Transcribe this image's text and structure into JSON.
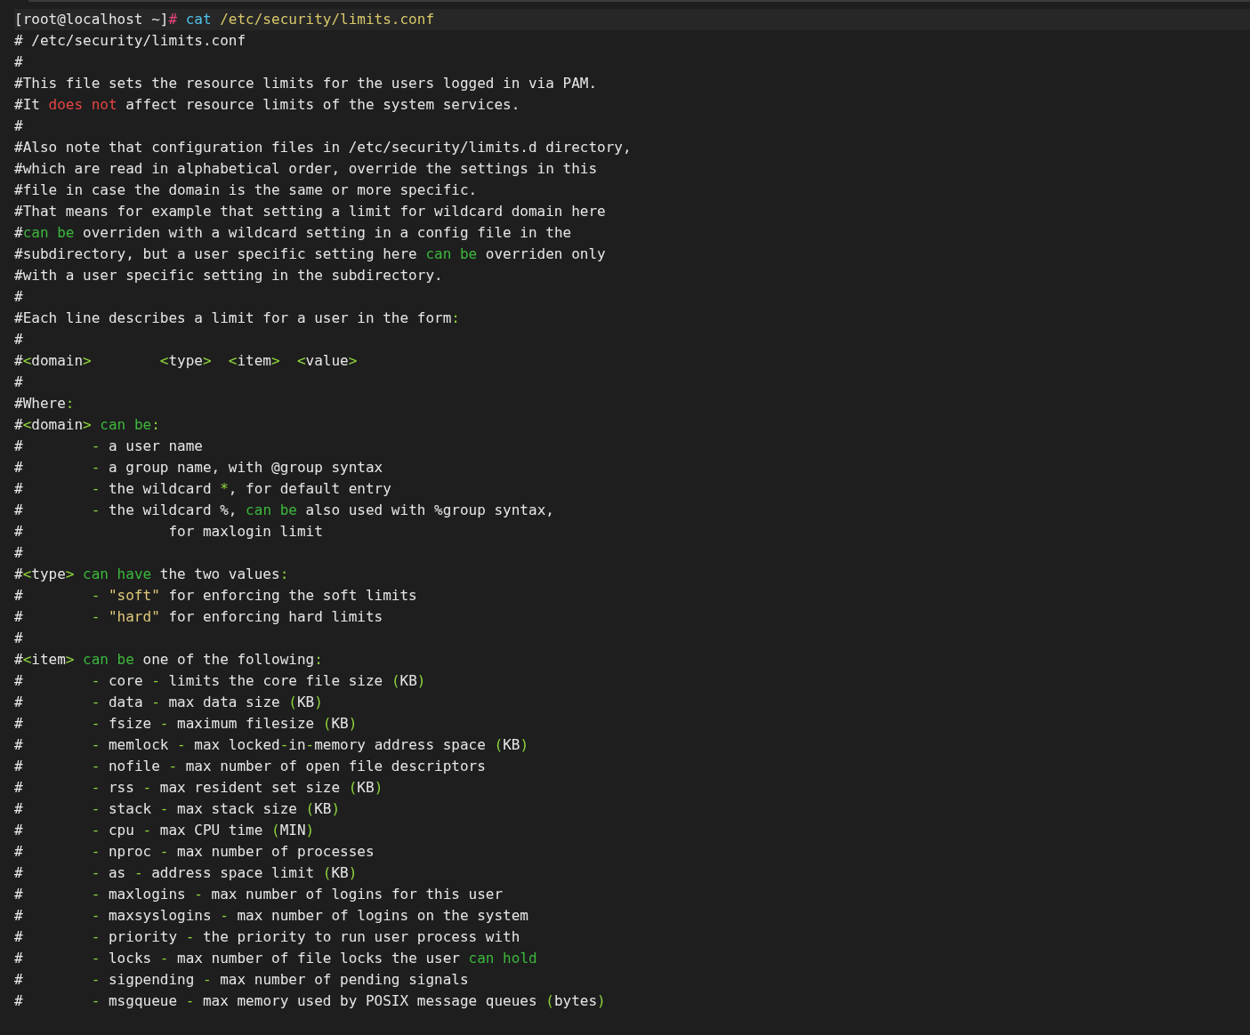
{
  "terminal": {
    "lines": [
      {
        "kind": "prompt",
        "segments": [
          {
            "kind": "plain",
            "text": "[root@localhost ~]"
          },
          {
            "kind": "hash",
            "text": "#"
          },
          {
            "kind": "command",
            "text": " cat"
          },
          {
            "kind": "path",
            "text": " /etc/security/limits.conf"
          }
        ]
      },
      {
        "kind": "output",
        "segments": [
          {
            "kind": "plain",
            "text": "# /etc/security/limits.conf"
          }
        ]
      },
      {
        "kind": "output",
        "segments": [
          {
            "kind": "plain",
            "text": "#"
          }
        ]
      },
      {
        "kind": "output",
        "segments": [
          {
            "kind": "plain",
            "text": "#This file sets the resource limits for the users logged in via PAM."
          }
        ]
      },
      {
        "kind": "output",
        "segments": [
          {
            "kind": "plain",
            "text": "#It "
          },
          {
            "kind": "negation",
            "text": "does not"
          },
          {
            "kind": "plain",
            "text": " affect resource limits of the system services."
          }
        ]
      },
      {
        "kind": "output",
        "segments": [
          {
            "kind": "plain",
            "text": "#"
          }
        ]
      },
      {
        "kind": "output",
        "segments": [
          {
            "kind": "plain",
            "text": "#Also note that configuration files in /etc/security/limits.d directory,"
          }
        ]
      },
      {
        "kind": "output",
        "segments": [
          {
            "kind": "plain",
            "text": "#which are read in alphabetical order, override the settings in this"
          }
        ]
      },
      {
        "kind": "output",
        "segments": [
          {
            "kind": "plain",
            "text": "#file in case the domain is the same or more specific."
          }
        ]
      },
      {
        "kind": "output",
        "segments": [
          {
            "kind": "plain",
            "text": "#That means for example that setting a limit for wildcard domain here"
          }
        ]
      },
      {
        "kind": "output",
        "segments": [
          {
            "kind": "plain",
            "text": "#"
          },
          {
            "kind": "keyword",
            "text": "can be"
          },
          {
            "kind": "plain",
            "text": " overriden with a wildcard setting in a config file in the"
          }
        ]
      },
      {
        "kind": "output",
        "segments": [
          {
            "kind": "plain",
            "text": "#subdirectory, but a user specific setting here "
          },
          {
            "kind": "keyword",
            "text": "can be"
          },
          {
            "kind": "plain",
            "text": " overriden only"
          }
        ]
      },
      {
        "kind": "output",
        "segments": [
          {
            "kind": "plain",
            "text": "#with a user specific setting in the subdirectory."
          }
        ]
      },
      {
        "kind": "output",
        "segments": [
          {
            "kind": "plain",
            "text": "#"
          }
        ]
      },
      {
        "kind": "output",
        "segments": [
          {
            "kind": "plain",
            "text": "#Each line describes a limit for a user in the form"
          },
          {
            "kind": "punct",
            "text": ":"
          }
        ]
      },
      {
        "kind": "output",
        "segments": [
          {
            "kind": "plain",
            "text": "#"
          }
        ]
      },
      {
        "kind": "output",
        "segments": [
          {
            "kind": "plain",
            "text": "#"
          },
          {
            "kind": "punct",
            "text": "<"
          },
          {
            "kind": "plain",
            "text": "domain"
          },
          {
            "kind": "punct",
            "text": ">        <"
          },
          {
            "kind": "plain",
            "text": "type"
          },
          {
            "kind": "punct",
            "text": ">  <"
          },
          {
            "kind": "plain",
            "text": "item"
          },
          {
            "kind": "punct",
            "text": ">  <"
          },
          {
            "kind": "plain",
            "text": "value"
          },
          {
            "kind": "punct",
            "text": ">"
          }
        ]
      },
      {
        "kind": "output",
        "segments": [
          {
            "kind": "plain",
            "text": "#"
          }
        ]
      },
      {
        "kind": "output",
        "segments": [
          {
            "kind": "plain",
            "text": "#Where"
          },
          {
            "kind": "punct",
            "text": ":"
          }
        ]
      },
      {
        "kind": "output",
        "segments": [
          {
            "kind": "plain",
            "text": "#"
          },
          {
            "kind": "punct",
            "text": "<"
          },
          {
            "kind": "plain",
            "text": "domain"
          },
          {
            "kind": "punct",
            "text": "> "
          },
          {
            "kind": "keyword",
            "text": "can be"
          },
          {
            "kind": "punct",
            "text": ":"
          }
        ]
      },
      {
        "kind": "output",
        "segments": [
          {
            "kind": "plain",
            "text": "#        "
          },
          {
            "kind": "punct",
            "text": "-"
          },
          {
            "kind": "plain",
            "text": " a user name"
          }
        ]
      },
      {
        "kind": "output",
        "segments": [
          {
            "kind": "plain",
            "text": "#        "
          },
          {
            "kind": "punct",
            "text": "-"
          },
          {
            "kind": "plain",
            "text": " a group name, with @group syntax"
          }
        ]
      },
      {
        "kind": "output",
        "segments": [
          {
            "kind": "plain",
            "text": "#        "
          },
          {
            "kind": "punct",
            "text": "-"
          },
          {
            "kind": "plain",
            "text": " the wildcard "
          },
          {
            "kind": "punct",
            "text": "*"
          },
          {
            "kind": "plain",
            "text": ", for default entry"
          }
        ]
      },
      {
        "kind": "output",
        "segments": [
          {
            "kind": "plain",
            "text": "#        "
          },
          {
            "kind": "punct",
            "text": "-"
          },
          {
            "kind": "plain",
            "text": " the wildcard %, "
          },
          {
            "kind": "keyword",
            "text": "can be"
          },
          {
            "kind": "plain",
            "text": " also used with %group syntax,"
          }
        ]
      },
      {
        "kind": "output",
        "segments": [
          {
            "kind": "plain",
            "text": "#                 for maxlogin limit"
          }
        ]
      },
      {
        "kind": "output",
        "segments": [
          {
            "kind": "plain",
            "text": "#"
          }
        ]
      },
      {
        "kind": "output",
        "segments": [
          {
            "kind": "plain",
            "text": "#"
          },
          {
            "kind": "punct",
            "text": "<"
          },
          {
            "kind": "plain",
            "text": "type"
          },
          {
            "kind": "punct",
            "text": "> "
          },
          {
            "kind": "keyword",
            "text": "can have"
          },
          {
            "kind": "plain",
            "text": " the two values"
          },
          {
            "kind": "punct",
            "text": ":"
          }
        ]
      },
      {
        "kind": "output",
        "segments": [
          {
            "kind": "plain",
            "text": "#        "
          },
          {
            "kind": "punct",
            "text": "- "
          },
          {
            "kind": "string",
            "text": "\"soft\""
          },
          {
            "kind": "plain",
            "text": " for enforcing the soft limits"
          }
        ]
      },
      {
        "kind": "output",
        "segments": [
          {
            "kind": "plain",
            "text": "#        "
          },
          {
            "kind": "punct",
            "text": "- "
          },
          {
            "kind": "string",
            "text": "\"hard\""
          },
          {
            "kind": "plain",
            "text": " for enforcing hard limits"
          }
        ]
      },
      {
        "kind": "output",
        "segments": [
          {
            "kind": "plain",
            "text": "#"
          }
        ]
      },
      {
        "kind": "output",
        "segments": [
          {
            "kind": "plain",
            "text": "#"
          },
          {
            "kind": "punct",
            "text": "<"
          },
          {
            "kind": "plain",
            "text": "item"
          },
          {
            "kind": "punct",
            "text": "> "
          },
          {
            "kind": "keyword",
            "text": "can be"
          },
          {
            "kind": "plain",
            "text": " one of the following"
          },
          {
            "kind": "punct",
            "text": ":"
          }
        ]
      },
      {
        "kind": "output",
        "segments": [
          {
            "kind": "plain",
            "text": "#        "
          },
          {
            "kind": "punct",
            "text": "-"
          },
          {
            "kind": "plain",
            "text": " core "
          },
          {
            "kind": "punct",
            "text": "-"
          },
          {
            "kind": "plain",
            "text": " limits the core file size "
          },
          {
            "kind": "punct",
            "text": "("
          },
          {
            "kind": "plain",
            "text": "KB"
          },
          {
            "kind": "punct",
            "text": ")"
          }
        ]
      },
      {
        "kind": "output",
        "segments": [
          {
            "kind": "plain",
            "text": "#        "
          },
          {
            "kind": "punct",
            "text": "-"
          },
          {
            "kind": "plain",
            "text": " data "
          },
          {
            "kind": "punct",
            "text": "-"
          },
          {
            "kind": "plain",
            "text": " max data size "
          },
          {
            "kind": "punct",
            "text": "("
          },
          {
            "kind": "plain",
            "text": "KB"
          },
          {
            "kind": "punct",
            "text": ")"
          }
        ]
      },
      {
        "kind": "output",
        "segments": [
          {
            "kind": "plain",
            "text": "#        "
          },
          {
            "kind": "punct",
            "text": "-"
          },
          {
            "kind": "plain",
            "text": " fsize "
          },
          {
            "kind": "punct",
            "text": "-"
          },
          {
            "kind": "plain",
            "text": " maximum filesize "
          },
          {
            "kind": "punct",
            "text": "("
          },
          {
            "kind": "plain",
            "text": "KB"
          },
          {
            "kind": "punct",
            "text": ")"
          }
        ]
      },
      {
        "kind": "output",
        "segments": [
          {
            "kind": "plain",
            "text": "#        "
          },
          {
            "kind": "punct",
            "text": "-"
          },
          {
            "kind": "plain",
            "text": " memlock "
          },
          {
            "kind": "punct",
            "text": "-"
          },
          {
            "kind": "plain",
            "text": " max locked"
          },
          {
            "kind": "punct",
            "text": "-"
          },
          {
            "kind": "plain",
            "text": "in"
          },
          {
            "kind": "punct",
            "text": "-"
          },
          {
            "kind": "plain",
            "text": "memory address space "
          },
          {
            "kind": "punct",
            "text": "("
          },
          {
            "kind": "plain",
            "text": "KB"
          },
          {
            "kind": "punct",
            "text": ")"
          }
        ]
      },
      {
        "kind": "output",
        "segments": [
          {
            "kind": "plain",
            "text": "#        "
          },
          {
            "kind": "punct",
            "text": "-"
          },
          {
            "kind": "plain",
            "text": " nofile "
          },
          {
            "kind": "punct",
            "text": "-"
          },
          {
            "kind": "plain",
            "text": " max number of open file descriptors"
          }
        ]
      },
      {
        "kind": "output",
        "segments": [
          {
            "kind": "plain",
            "text": "#        "
          },
          {
            "kind": "punct",
            "text": "-"
          },
          {
            "kind": "plain",
            "text": " rss "
          },
          {
            "kind": "punct",
            "text": "-"
          },
          {
            "kind": "plain",
            "text": " max resident set size "
          },
          {
            "kind": "punct",
            "text": "("
          },
          {
            "kind": "plain",
            "text": "KB"
          },
          {
            "kind": "punct",
            "text": ")"
          }
        ]
      },
      {
        "kind": "output",
        "segments": [
          {
            "kind": "plain",
            "text": "#        "
          },
          {
            "kind": "punct",
            "text": "-"
          },
          {
            "kind": "plain",
            "text": " stack "
          },
          {
            "kind": "punct",
            "text": "-"
          },
          {
            "kind": "plain",
            "text": " max stack size "
          },
          {
            "kind": "punct",
            "text": "("
          },
          {
            "kind": "plain",
            "text": "KB"
          },
          {
            "kind": "punct",
            "text": ")"
          }
        ]
      },
      {
        "kind": "output",
        "segments": [
          {
            "kind": "plain",
            "text": "#        "
          },
          {
            "kind": "punct",
            "text": "-"
          },
          {
            "kind": "plain",
            "text": " cpu "
          },
          {
            "kind": "punct",
            "text": "-"
          },
          {
            "kind": "plain",
            "text": " max CPU time "
          },
          {
            "kind": "punct",
            "text": "("
          },
          {
            "kind": "plain",
            "text": "MIN"
          },
          {
            "kind": "punct",
            "text": ")"
          }
        ]
      },
      {
        "kind": "output",
        "segments": [
          {
            "kind": "plain",
            "text": "#        "
          },
          {
            "kind": "punct",
            "text": "-"
          },
          {
            "kind": "plain",
            "text": " nproc "
          },
          {
            "kind": "punct",
            "text": "-"
          },
          {
            "kind": "plain",
            "text": " max number of processes"
          }
        ]
      },
      {
        "kind": "output",
        "segments": [
          {
            "kind": "plain",
            "text": "#        "
          },
          {
            "kind": "punct",
            "text": "-"
          },
          {
            "kind": "plain",
            "text": " as "
          },
          {
            "kind": "punct",
            "text": "-"
          },
          {
            "kind": "plain",
            "text": " address space limit "
          },
          {
            "kind": "punct",
            "text": "("
          },
          {
            "kind": "plain",
            "text": "KB"
          },
          {
            "kind": "punct",
            "text": ")"
          }
        ]
      },
      {
        "kind": "output",
        "segments": [
          {
            "kind": "plain",
            "text": "#        "
          },
          {
            "kind": "punct",
            "text": "-"
          },
          {
            "kind": "plain",
            "text": " maxlogins "
          },
          {
            "kind": "punct",
            "text": "-"
          },
          {
            "kind": "plain",
            "text": " max number of logins for this user"
          }
        ]
      },
      {
        "kind": "output",
        "segments": [
          {
            "kind": "plain",
            "text": "#        "
          },
          {
            "kind": "punct",
            "text": "-"
          },
          {
            "kind": "plain",
            "text": " maxsyslogins "
          },
          {
            "kind": "punct",
            "text": "-"
          },
          {
            "kind": "plain",
            "text": " max number of logins on the system"
          }
        ]
      },
      {
        "kind": "output",
        "segments": [
          {
            "kind": "plain",
            "text": "#        "
          },
          {
            "kind": "punct",
            "text": "-"
          },
          {
            "kind": "plain",
            "text": " priority "
          },
          {
            "kind": "punct",
            "text": "-"
          },
          {
            "kind": "plain",
            "text": " the priority to run user process with"
          }
        ]
      },
      {
        "kind": "output",
        "segments": [
          {
            "kind": "plain",
            "text": "#        "
          },
          {
            "kind": "punct",
            "text": "-"
          },
          {
            "kind": "plain",
            "text": " locks "
          },
          {
            "kind": "punct",
            "text": "-"
          },
          {
            "kind": "plain",
            "text": " max number of file locks the user "
          },
          {
            "kind": "keyword",
            "text": "can hold"
          }
        ]
      },
      {
        "kind": "output",
        "segments": [
          {
            "kind": "plain",
            "text": "#        "
          },
          {
            "kind": "punct",
            "text": "-"
          },
          {
            "kind": "plain",
            "text": " sigpending "
          },
          {
            "kind": "punct",
            "text": "-"
          },
          {
            "kind": "plain",
            "text": " max number of pending signals"
          }
        ]
      },
      {
        "kind": "output",
        "segments": [
          {
            "kind": "plain",
            "text": "#        "
          },
          {
            "kind": "punct",
            "text": "-"
          },
          {
            "kind": "plain",
            "text": " msgqueue "
          },
          {
            "kind": "punct",
            "text": "-"
          },
          {
            "kind": "plain",
            "text": " max memory used by POSIX message queues "
          },
          {
            "kind": "punct",
            "text": "("
          },
          {
            "kind": "plain",
            "text": "bytes"
          },
          {
            "kind": "punct",
            "text": ")"
          }
        ]
      }
    ]
  }
}
